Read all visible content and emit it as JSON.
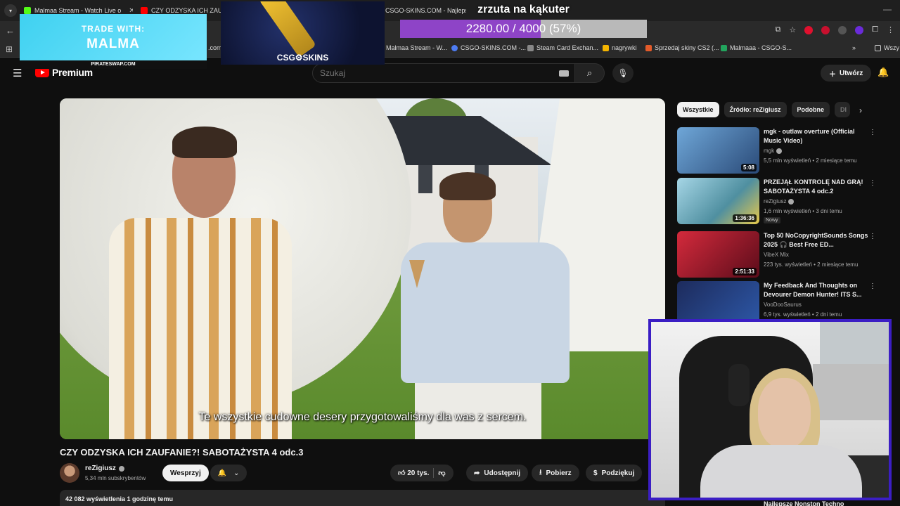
{
  "browser": {
    "tabs": [
      {
        "label": "Malmaa Stream - Watch Live o",
        "favicon_color": "#53fc18"
      },
      {
        "label": "CZY ODZYSKA ICH ZAUFAN",
        "favicon_color": "#ff0000"
      },
      {
        "label": "CSGO-SKINS.COM - Najlepsze",
        "favicon_color": "#2a5fd6"
      }
    ],
    "bookmarks": [
      {
        "label": "Malmaa Stream - W...",
        "icon_color": "#53fc18"
      },
      {
        "label": "CSGO-SKINS.COM -...",
        "icon_color": "#4d7cf3"
      },
      {
        "label": "Steam Card Exchan...",
        "icon_color": "#888888"
      },
      {
        "label": "nagrywki",
        "icon_color": "#f4b400"
      },
      {
        "label": "Sprzedaj skiny CS2 (...",
        "icon_color": "#e35b2a"
      },
      {
        "label": "Malmaaa - CSGO-S...",
        "icon_color": "#22a45d"
      },
      {
        "label": "Wszy",
        "icon_color": "#cccccc"
      }
    ],
    "bookmark_left_fragment": ".com"
  },
  "youtube": {
    "logo_text": "Premium",
    "search_placeholder": "Szukaj",
    "create_label": "Utwórz",
    "subtitle": "Te wszystkie cudowne desery przygotowaliśmy dla was z sercem.",
    "video_title": "CZY ODZYSKA ICH ZAUFANIE?! SABOTAŻYSTA 4 odc.3",
    "channel_name": "reZigiusz",
    "subscribers": "5,34 mln subskrybentów",
    "support_label": "Wesprzyj",
    "likes": "20 tys.",
    "share_label": "Udostępnij",
    "download_label": "Pobierz",
    "thanks_label": "Podziękuj",
    "views_line": "42 082 wyświetlenia  1 godzinę temu"
  },
  "sidebar": {
    "chips": [
      {
        "label": "Wszystkie",
        "active": true
      },
      {
        "label": "Źródło: reZigiusz",
        "active": false
      },
      {
        "label": "Podobne",
        "active": false
      },
      {
        "label": "Dl",
        "active": false
      }
    ],
    "recommendations": [
      {
        "title": "mgk - outlaw overture (Official Music Video)",
        "channel": "mgk",
        "meta": "5,5 mln wyświetleń • 2 miesiące temu",
        "duration": "5:08",
        "badge": "",
        "thumb_color": "#3d6aa8"
      },
      {
        "title": "PRZEJĄŁ KONTROLĘ NAD GRĄ! SABOTAŻYSTA 4 odc.2",
        "channel": "reZigiusz",
        "meta": "1,6 mln wyświetleń • 3 dni temu",
        "duration": "1:36:36",
        "badge": "Nowy",
        "thumb_color": "#7fb6c8"
      },
      {
        "title": "Top 50 NoCopyrightSounds Songs 2025 🎧 Best Free ED...",
        "channel": "VibeX Mix",
        "meta": "223 tys. wyświetleń • 2 miesiące temu",
        "duration": "2:51:33",
        "badge": "",
        "thumb_color": "#b3172e"
      },
      {
        "title": "My Feedback And Thoughts on Devourer Demon Hunter! ITS S...",
        "channel": "VooDooSaurus",
        "meta": "6,9 tys. wyświetleń • 2 dni temu",
        "duration": "",
        "badge": "",
        "thumb_color": "#1d2b5c"
      }
    ],
    "partial_item_title": "Najlepsze Nonston Techno"
  },
  "overlays": {
    "trade_line1": "TRADE WITH:",
    "trade_line2": "MALMA",
    "trade_footer": "PIRATESWAP.COM",
    "csg_label": "CSG⚙SKINS",
    "goal_title": "zrzuta na kąkuter",
    "goal_text": "2280.00 / 4000 (57%)",
    "goal_progress": 0.57,
    "goal_fill_color": "#8e44c7",
    "webcam_border_color": "#3b1ec4"
  }
}
